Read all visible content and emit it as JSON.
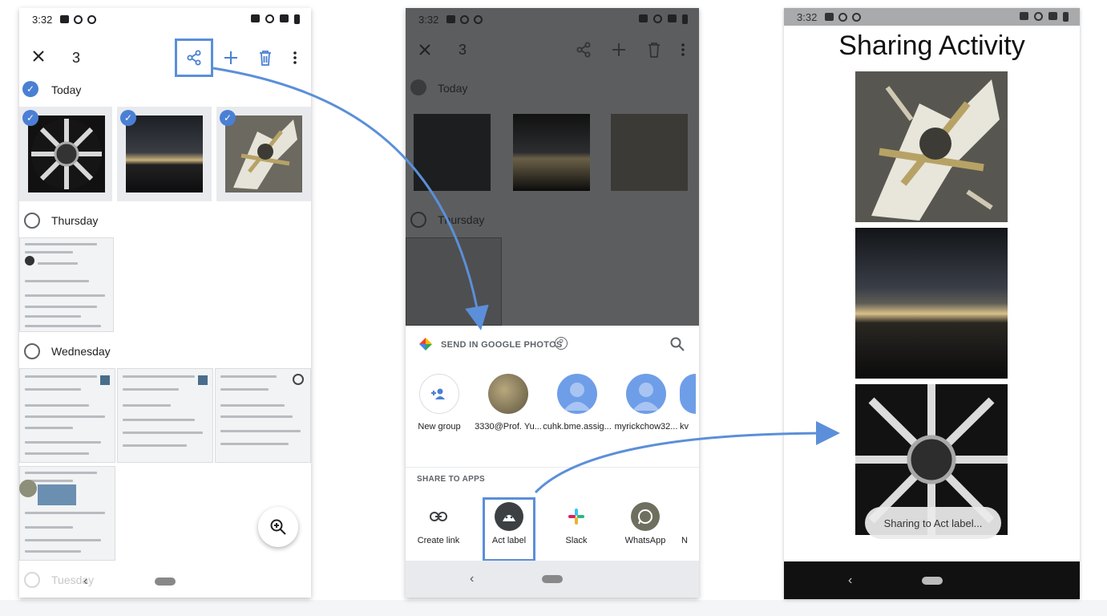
{
  "status": {
    "time": "3:32"
  },
  "phone1": {
    "selected_count": "3",
    "sections": {
      "today": "Today",
      "thursday": "Thursday",
      "wednesday": "Wednesday",
      "tuesday": "Tuesday"
    },
    "icons": [
      "close-icon",
      "share-icon",
      "add-icon",
      "trash-icon",
      "more-icon",
      "zoom-in-icon"
    ]
  },
  "phone2": {
    "sections": {
      "today": "Today",
      "thursday": "Thursday"
    },
    "selected_count": "3",
    "send_header": "SEND IN GOOGLE PHOTOS",
    "contacts": [
      {
        "label": "New group"
      },
      {
        "label": "3330@Prof. Yu..."
      },
      {
        "label": "cuhk.bme.assig..."
      },
      {
        "label": "myrickchow32..."
      },
      {
        "label": "kv"
      }
    ],
    "share_apps_title": "SHARE TO APPS",
    "apps": [
      {
        "label": "Create link"
      },
      {
        "label": "Act label"
      },
      {
        "label": "Slack"
      },
      {
        "label": "WhatsApp"
      },
      {
        "label": "N"
      }
    ]
  },
  "phone3": {
    "title": "Sharing Activity",
    "toast": "Sharing to Act label..."
  },
  "colors": {
    "accent": "#4a7fd4",
    "highlight": "#5b8fd9",
    "dim": "#5c5d5f"
  }
}
